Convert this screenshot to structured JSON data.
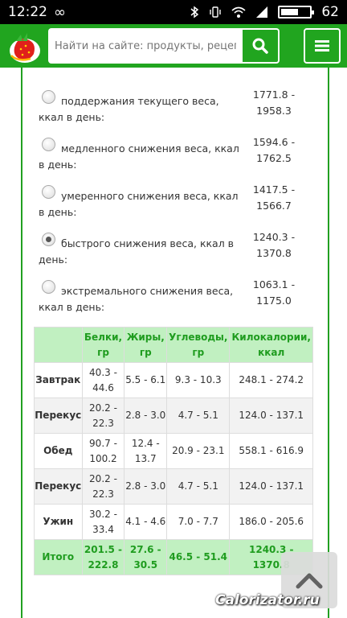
{
  "status_bar": {
    "time": "12:22",
    "infinity_glyph": "∞",
    "battery_level": "62",
    "battery_fraction": 0.62,
    "icons": [
      "bluetooth-icon",
      "vibrate-icon",
      "wifi-icon",
      "signal-icon",
      "battery-icon"
    ]
  },
  "header": {
    "search_placeholder": "Найти на сайте: продукты, рецепты, с",
    "brand_color": "#21a51f"
  },
  "options": [
    {
      "label": "поддержания текущего веса, ккал в день:",
      "value_line1": "1771.8 -",
      "value_line2": "1958.3",
      "checked": false
    },
    {
      "label": "медленного снижения веса, ккал в день:",
      "value_line1": "1594.6 -",
      "value_line2": "1762.5",
      "checked": false
    },
    {
      "label": "умеренного снижения веса, ккал в день:",
      "value_line1": "1417.5 -",
      "value_line2": "1566.7",
      "checked": false
    },
    {
      "label": "быстрого снижения веса, ккал в день:",
      "value_line1": "1240.3 -",
      "value_line2": "1370.8",
      "checked": true
    },
    {
      "label": "экстремального снижения веса, ккал в день:",
      "value_line1": "1063.1 -",
      "value_line2": "1175.0",
      "checked": false
    }
  ],
  "table": {
    "headers": [
      "",
      "Белки, гр",
      "Жиры, гр",
      "Углеводы, гр",
      "Килокалории, ккал"
    ],
    "rows": [
      {
        "name": "Завтрак",
        "protein": "40.3 - 44.6",
        "fat": "5.5 - 6.1",
        "carbs": "9.3 - 10.3",
        "kcal": "248.1 - 274.2"
      },
      {
        "name": "Перекус",
        "protein": "20.2 - 22.3",
        "fat": "2.8 - 3.0",
        "carbs": "4.7 - 5.1",
        "kcal": "124.0 - 137.1"
      },
      {
        "name": "Обед",
        "protein": "90.7 - 100.2",
        "fat": "12.4 - 13.7",
        "carbs": "20.9 - 23.1",
        "kcal": "558.1 - 616.9"
      },
      {
        "name": "Перекус",
        "protein": "20.2 - 22.3",
        "fat": "2.8 - 3.0",
        "carbs": "4.7 - 5.1",
        "kcal": "124.0 - 137.1"
      },
      {
        "name": "Ужин",
        "protein": "30.2 - 33.4",
        "fat": "4.1 - 4.6",
        "carbs": "7.0 - 7.7",
        "kcal": "186.0 - 205.6"
      }
    ],
    "total": {
      "name": "Итого",
      "protein": "201.5 - 222.8",
      "fat": "27.6 - 30.5",
      "carbs": "46.5 - 51.4",
      "kcal": "1240.3 - 1370.8"
    }
  },
  "watermark": "Calorizator.ru"
}
